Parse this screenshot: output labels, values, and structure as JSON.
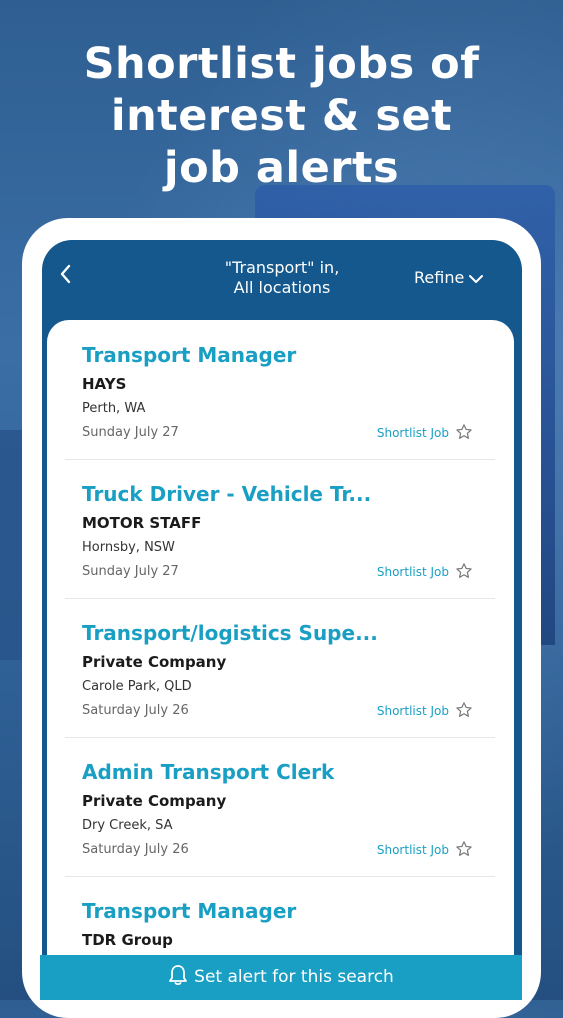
{
  "headline": [
    "Shortlist jobs of",
    "interest & set",
    "job alerts"
  ],
  "header": {
    "query_line1": "\"Transport\" in,",
    "query_line2": "All locations",
    "refine_label": "Refine"
  },
  "jobs": [
    {
      "title": "Transport Manager",
      "company": "HAYS",
      "location": "Perth, WA",
      "date": "Sunday July 27",
      "shortlist_label": "Shortlist Job"
    },
    {
      "title": "Truck Driver - Vehicle Tr...",
      "company": "MOTOR STAFF",
      "location": "Hornsby, NSW",
      "date": "Sunday July 27",
      "shortlist_label": "Shortlist Job"
    },
    {
      "title": "Transport/logistics Supe...",
      "company": "Private Company",
      "location": "Carole Park, QLD",
      "date": "Saturday July 26",
      "shortlist_label": "Shortlist Job"
    },
    {
      "title": "Admin Transport Clerk",
      "company": "Private Company",
      "location": "Dry Creek, SA",
      "date": "Saturday July 26",
      "shortlist_label": "Shortlist Job"
    },
    {
      "title": "Transport Manager",
      "company": "TDR Group",
      "location": "",
      "date": "",
      "shortlist_label": ""
    }
  ],
  "alert_button": {
    "label": "Set alert for this search",
    "icon": "bell-icon"
  },
  "colors": {
    "accent": "#1a9fc4",
    "header_bg": "#14588e"
  }
}
